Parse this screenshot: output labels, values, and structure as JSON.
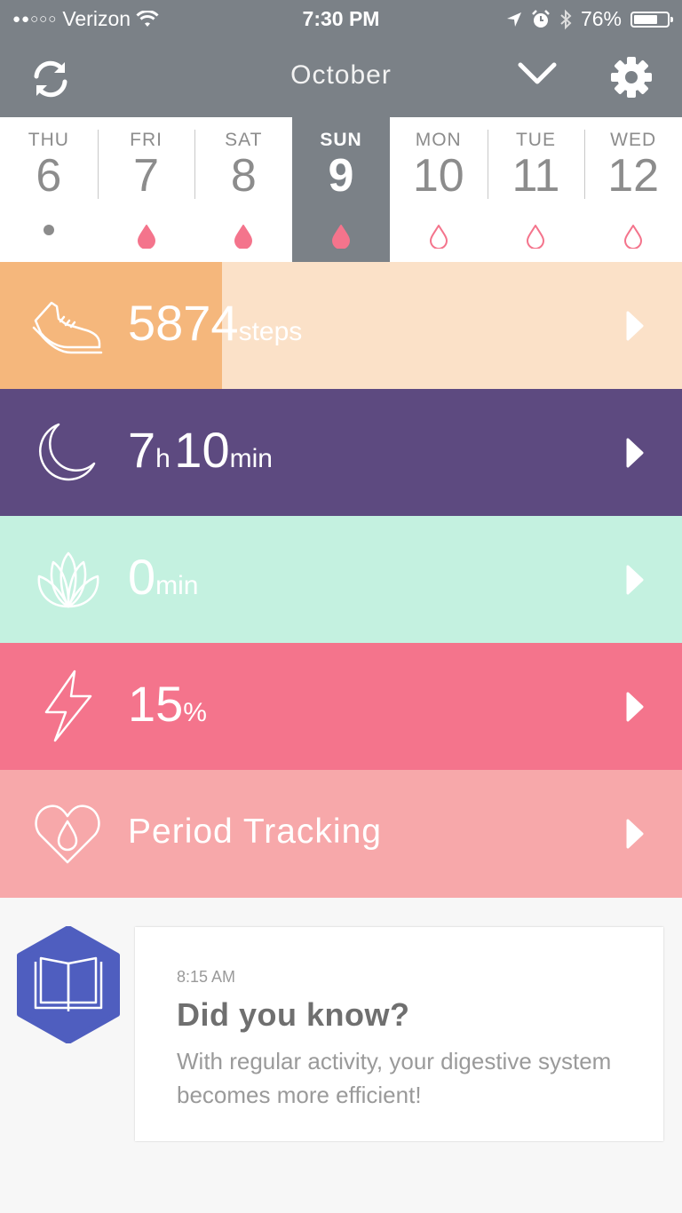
{
  "status_bar": {
    "carrier": "Verizon",
    "time": "7:30 PM",
    "battery": "76%",
    "battery_level": 0.76,
    "icons": [
      "signal-dots-icon",
      "wifi-icon",
      "location-icon",
      "alarm-icon",
      "bluetooth-icon",
      "battery-icon"
    ]
  },
  "header": {
    "month": "October",
    "icons": [
      "sync-icon",
      "chevron-down-icon",
      "gear-icon"
    ]
  },
  "days": [
    {
      "name": "THU",
      "num": "6",
      "mark": "dot"
    },
    {
      "name": "FRI",
      "num": "7",
      "mark": "drop-filled"
    },
    {
      "name": "SAT",
      "num": "8",
      "mark": "drop-filled"
    },
    {
      "name": "SUN",
      "num": "9",
      "mark": "drop-filled",
      "selected": true
    },
    {
      "name": "MON",
      "num": "10",
      "mark": "drop-outline"
    },
    {
      "name": "TUE",
      "num": "11",
      "mark": "drop-outline"
    },
    {
      "name": "WED",
      "num": "12",
      "mark": "drop-outline"
    }
  ],
  "metrics": {
    "steps": {
      "value": "5874",
      "unit": "steps",
      "progress": 0.325,
      "icon": "shoe-icon"
    },
    "sleep": {
      "hours": "7",
      "hours_unit": "h",
      "minutes": "10",
      "minutes_unit": "min",
      "icon": "moon-icon"
    },
    "meditation": {
      "value": "0",
      "unit": "min",
      "icon": "lotus-icon"
    },
    "energy": {
      "value": "15",
      "unit": "%",
      "icon": "lightning-icon"
    },
    "period": {
      "label": "Period Tracking",
      "icon": "heart-drop-icon"
    }
  },
  "colors": {
    "header": "#7b8187",
    "steps_bg": "#fbe1c8",
    "steps_fill": "#f5b77c",
    "sleep": "#5d4a80",
    "meditation": "#c4f1e0",
    "energy": "#f4748c",
    "period": "#f7a8aa",
    "drop": "#f4748c",
    "book_hex": "#4f5ebf"
  },
  "card": {
    "time": "8:15 AM",
    "title": "Did you know?",
    "body": "With regular activity, your digestive system becomes more efficient!",
    "icon": "book-icon"
  }
}
